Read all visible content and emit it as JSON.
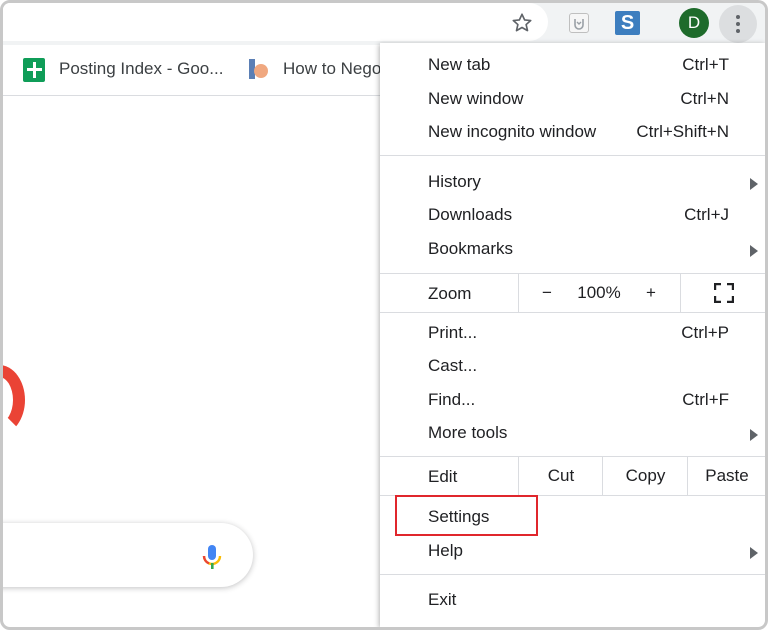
{
  "toolbar": {
    "icons": [
      "star-icon",
      "extension-icon",
      "s-extension-icon",
      "avatar",
      "kebab-menu-icon"
    ],
    "extension_letter": "S",
    "avatar_initial": "D",
    "avatar_color": "#1e6b2b"
  },
  "bookmarks": [
    {
      "label": "Posting Index - Goo...",
      "icon": "sheets-icon"
    },
    {
      "label": "How to Nego",
      "icon": "doc-icon"
    }
  ],
  "menu": {
    "group1": [
      {
        "label": "New tab",
        "shortcut": "Ctrl+T"
      },
      {
        "label": "New window",
        "shortcut": "Ctrl+N"
      },
      {
        "label": "New incognito window",
        "shortcut": "Ctrl+Shift+N"
      }
    ],
    "group2": [
      {
        "label": "History",
        "shortcut": "",
        "submenu": true
      },
      {
        "label": "Downloads",
        "shortcut": "Ctrl+J"
      },
      {
        "label": "Bookmarks",
        "shortcut": "",
        "submenu": true
      }
    ],
    "zoom": {
      "label": "Zoom",
      "minus": "−",
      "value": "100%",
      "plus": "+"
    },
    "group3": [
      {
        "label": "Print...",
        "shortcut": "Ctrl+P"
      },
      {
        "label": "Cast...",
        "shortcut": ""
      },
      {
        "label": "Find...",
        "shortcut": "Ctrl+F"
      },
      {
        "label": "More tools",
        "shortcut": "",
        "submenu": true
      }
    ],
    "edit": {
      "label": "Edit",
      "cut": "Cut",
      "copy": "Copy",
      "paste": "Paste"
    },
    "group4": [
      {
        "label": "Settings",
        "highlighted": true
      },
      {
        "label": "Help",
        "submenu": true
      }
    ],
    "exit": {
      "label": "Exit"
    }
  },
  "colors": {
    "highlight": "#e0262c",
    "accent_red": "#ea4335"
  }
}
